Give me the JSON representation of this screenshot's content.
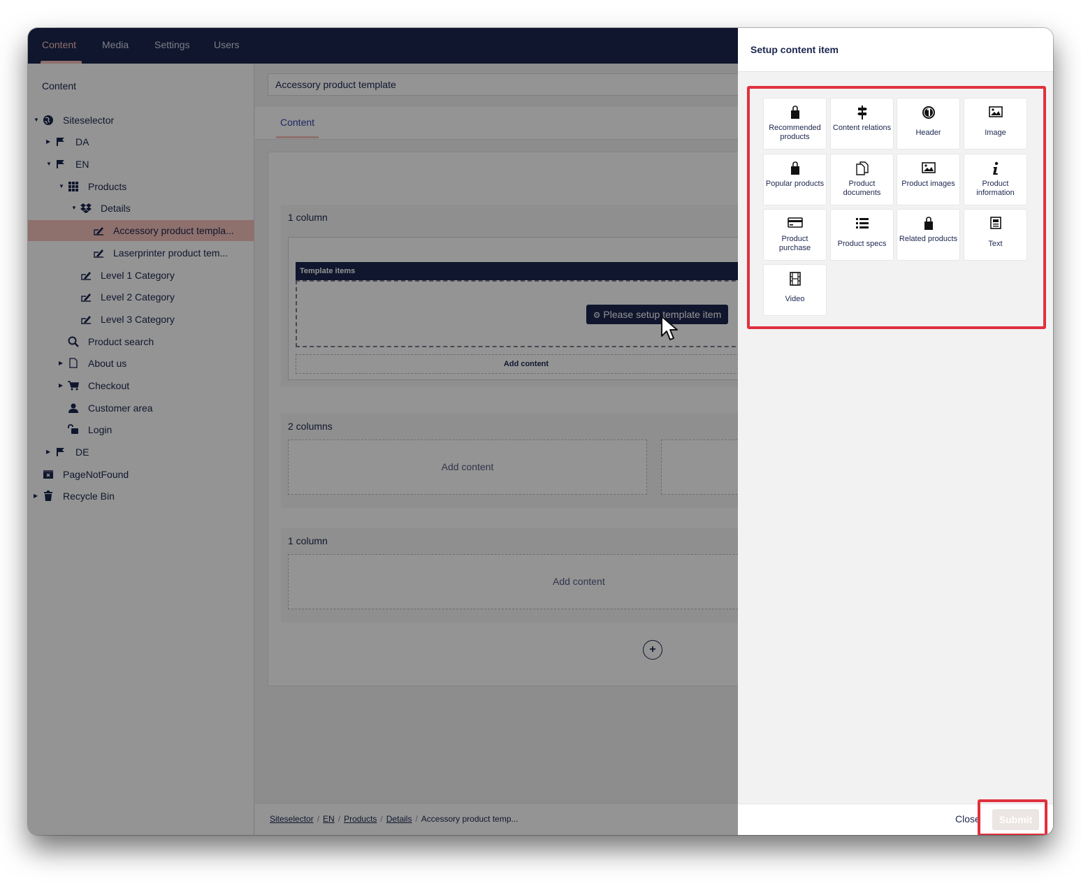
{
  "topnav": {
    "tabs": [
      {
        "label": "Content"
      },
      {
        "label": "Media"
      },
      {
        "label": "Settings"
      },
      {
        "label": "Users"
      }
    ]
  },
  "sidebar": {
    "title": "Content",
    "items": [
      {
        "label": "Siteselector"
      },
      {
        "label": "DA"
      },
      {
        "label": "EN"
      },
      {
        "label": "Products"
      },
      {
        "label": "Details"
      },
      {
        "label": "Accessory product templa..."
      },
      {
        "label": "Laserprinter product tem..."
      },
      {
        "label": "Level 1 Category"
      },
      {
        "label": "Level 2 Category"
      },
      {
        "label": "Level 3 Category"
      },
      {
        "label": "Product search"
      },
      {
        "label": "About us"
      },
      {
        "label": "Checkout"
      },
      {
        "label": "Customer area"
      },
      {
        "label": "Login"
      },
      {
        "label": "DE"
      },
      {
        "label": "PageNotFound"
      },
      {
        "label": "Recycle Bin"
      }
    ]
  },
  "editor": {
    "name_value": "Accessory product template",
    "tab_label": "Content",
    "sections": [
      {
        "title": "1 column"
      },
      {
        "title": "2 columns"
      },
      {
        "title": "1 column"
      }
    ],
    "template_items_label": "Template items",
    "setup_button_label": "Please setup template item",
    "add_content_label": "Add content"
  },
  "breadcrumb": {
    "links": [
      "Siteselector",
      "EN",
      "Products",
      "Details"
    ],
    "current": "Accessory product temp..."
  },
  "panel": {
    "title": "Setup content item",
    "items": [
      {
        "label": "Recommended products",
        "icon": "shopping-bag-icon"
      },
      {
        "label": "Content relations",
        "icon": "signpost-icon"
      },
      {
        "label": "Header",
        "icon": "number-one-icon"
      },
      {
        "label": "Image",
        "icon": "picture-icon"
      },
      {
        "label": "Popular products",
        "icon": "shopping-bag-icon"
      },
      {
        "label": "Product documents",
        "icon": "documents-icon"
      },
      {
        "label": "Product images",
        "icon": "picture-icon"
      },
      {
        "label": "Product information",
        "icon": "info-icon"
      },
      {
        "label": "Product purchase",
        "icon": "credit-card-icon"
      },
      {
        "label": "Product specs",
        "icon": "list-icon"
      },
      {
        "label": "Related products",
        "icon": "shopping-bag-icon"
      },
      {
        "label": "Text",
        "icon": "newspaper-icon"
      },
      {
        "label": "Video",
        "icon": "film-icon"
      }
    ],
    "close_label": "Close",
    "submit_label": "Submit"
  },
  "colors": {
    "brand_navy": "#1b264f",
    "accent_pink": "#f5c1bc",
    "highlight_red": "#e0313e"
  }
}
